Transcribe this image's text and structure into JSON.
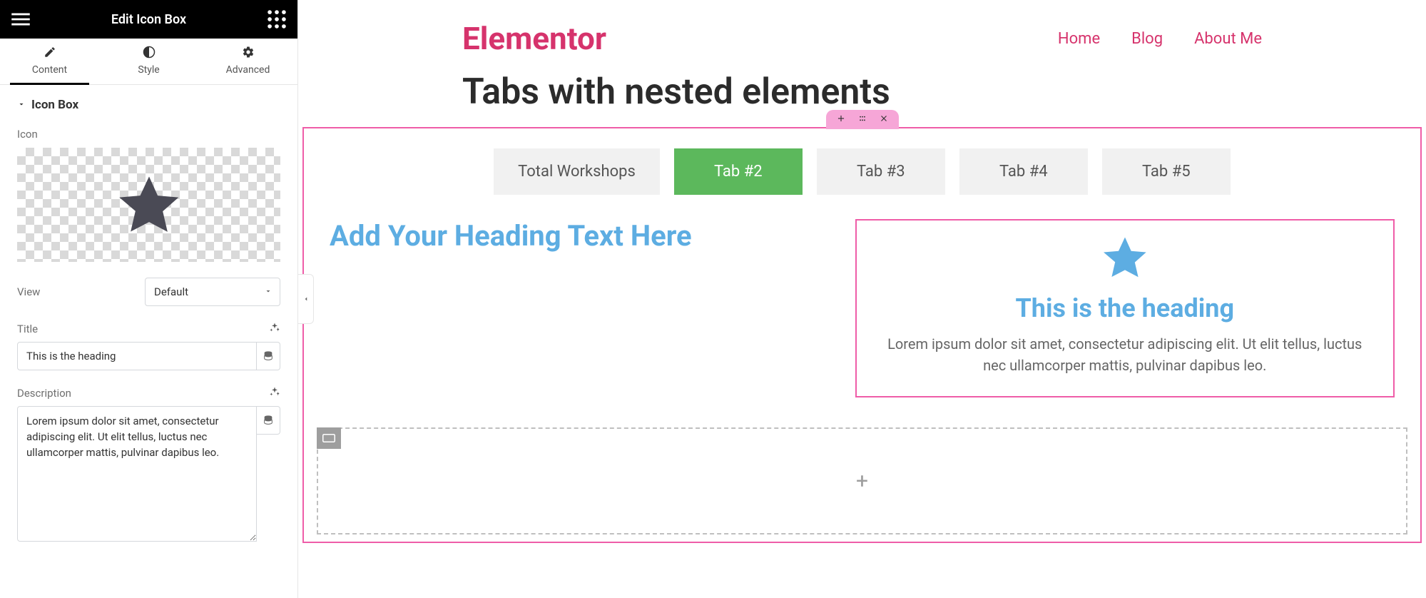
{
  "panel": {
    "title": "Edit Icon Box",
    "tabs": {
      "content": "Content",
      "style": "Style",
      "advanced": "Advanced"
    },
    "section_title": "Icon Box",
    "icon_label": "Icon",
    "view_label": "View",
    "view_value": "Default",
    "title_label": "Title",
    "title_value": "This is the heading",
    "description_label": "Description",
    "description_value": "Lorem ipsum dolor sit amet, consectetur adipiscing elit. Ut elit tellus, luctus nec ullamcorper mattis, pulvinar dapibus leo."
  },
  "site": {
    "brand": "Elementor",
    "nav": {
      "home": "Home",
      "blog": "Blog",
      "about": "About Me"
    },
    "page_title": "Tabs with nested elements"
  },
  "tabs": {
    "items": [
      "Total Workshops",
      "Tab #2",
      "Tab #3",
      "Tab #4",
      "Tab #5"
    ],
    "active_index": 1
  },
  "content": {
    "heading_placeholder": "Add Your Heading Text Here",
    "iconbox": {
      "title": "This is the heading",
      "description": "Lorem ipsum dolor sit amet, consectetur adipiscing elit. Ut elit tellus, luctus nec ullamcorper mattis, pulvinar dapibus leo."
    }
  }
}
